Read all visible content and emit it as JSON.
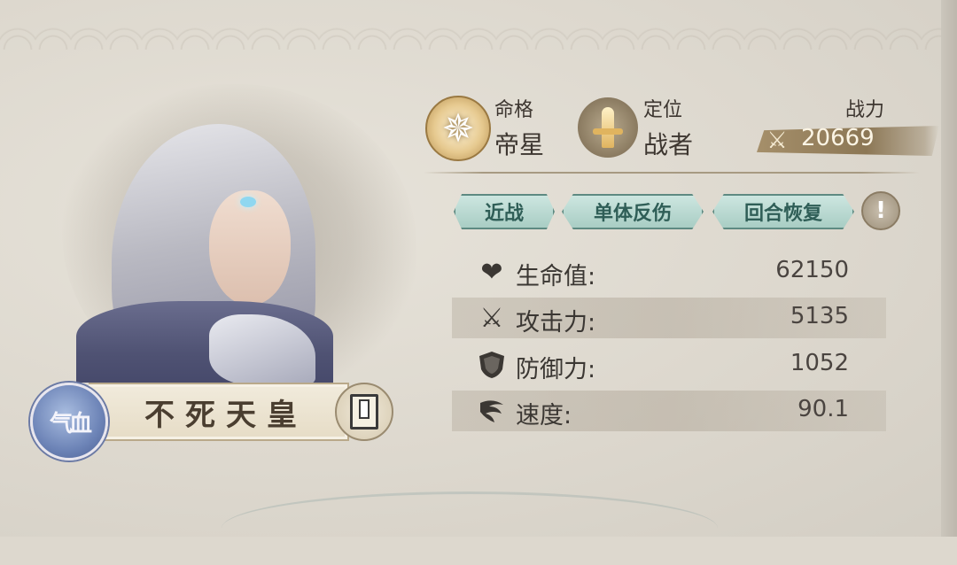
{
  "hero": {
    "name": "不死天皇",
    "qixue_badge": "气血"
  },
  "header": {
    "fate_label": "命格",
    "fate_value": "帝星",
    "role_label": "定位",
    "role_value": "战者",
    "power_label": "战力",
    "power_value": "20669"
  },
  "tags": [
    {
      "label": "近战"
    },
    {
      "label": "单体反伤"
    },
    {
      "label": "回合恢复"
    }
  ],
  "info_button": "!",
  "stats": [
    {
      "label": "生命值:",
      "value": "62150",
      "icon": "heart-icon"
    },
    {
      "label": "攻击力:",
      "value": "5135",
      "icon": "sword-icon"
    },
    {
      "label": "防御力:",
      "value": "1052",
      "icon": "shield-icon"
    },
    {
      "label": "速度:",
      "value": "90.1",
      "icon": "wind-icon"
    }
  ],
  "colors": {
    "background": "#ddd8ce",
    "tag_fill": "#cde6e0",
    "tag_border": "#5e8a82",
    "power_bar": "#8c7755",
    "nameplate": "#f1ebdc"
  }
}
